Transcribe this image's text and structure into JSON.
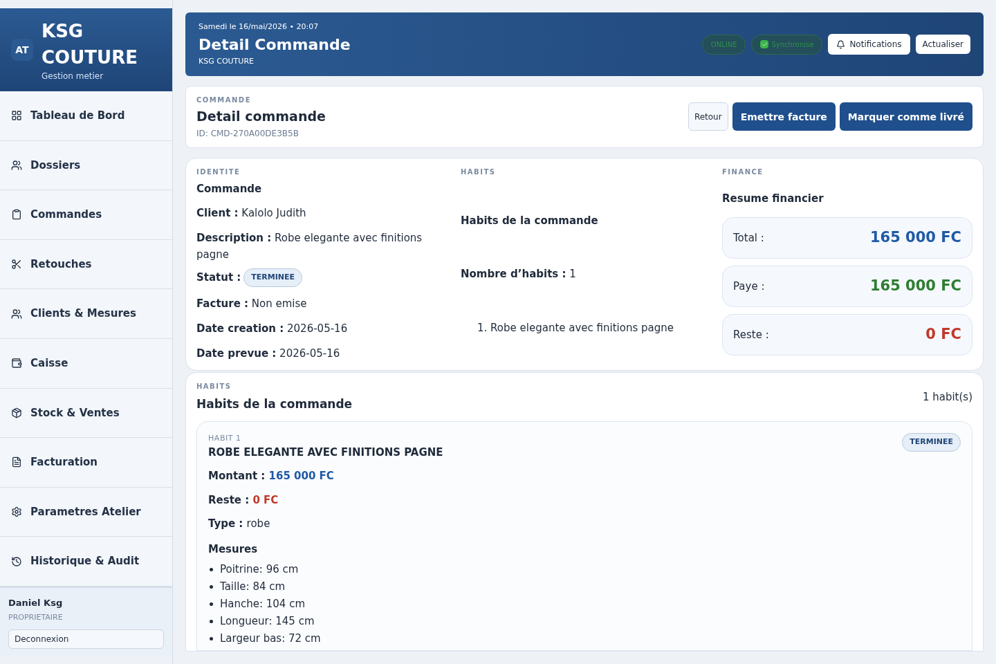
{
  "sidebar": {
    "logo_badge": "AT",
    "brand": "KSG COUTURE",
    "tagline": "Gestion metier",
    "items": [
      {
        "label": "Tableau de Bord",
        "selected": false
      },
      {
        "label": "Dossiers",
        "selected": false
      },
      {
        "label": "Commandes",
        "selected": false
      },
      {
        "label": "Retouches",
        "selected": false
      },
      {
        "label": "Clients & Mesures",
        "selected": false
      },
      {
        "label": "Caisse",
        "selected": false
      },
      {
        "label": "Stock & Ventes",
        "selected": false
      },
      {
        "label": "Facturation",
        "selected": false
      },
      {
        "label": "Parametres Atelier",
        "selected": false
      },
      {
        "label": "Historique & Audit",
        "selected": false
      }
    ],
    "user": {
      "name": "Daniel Ksg",
      "role": "PROPRIETAIRE",
      "logout": "Deconnexion"
    }
  },
  "header": {
    "date": "Samedi le 16/mai/2026 • 20:07",
    "title": "Detail Commande",
    "subtitle": "KSG COUTURE",
    "online": "ONLINE",
    "sync": {
      "label": "Synchronise",
      "checked": true
    },
    "notifications": "Notifications",
    "refresh": "Actualiser"
  },
  "order": {
    "eyebrow": "COMMANDE",
    "title": "Detail commande",
    "id": "ID: CMD-270A00DE3B5B",
    "buttons": [
      {
        "label": "Retour",
        "kind": "secondary"
      },
      {
        "label": "Emettre facture",
        "kind": "primary"
      },
      {
        "label": "Marquer comme livré",
        "kind": "primary"
      }
    ]
  },
  "identite": {
    "eyebrow": "IDENTITE",
    "title": "Commande",
    "fields": [
      {
        "label": "Client :",
        "value": "Kalolo Judith",
        "kind": "text"
      },
      {
        "label": "Description :",
        "value": "Robe elegante avec finitions pagne",
        "kind": "text"
      },
      {
        "label": "Statut :",
        "value": "TERMINEE",
        "kind": "badge"
      },
      {
        "label": "Facture :",
        "value": "Non emise",
        "kind": "text"
      },
      {
        "label": "Date creation :",
        "value": "2026-05-16",
        "kind": "text"
      },
      {
        "label": "Date prevue :",
        "value": "2026-05-16",
        "kind": "text"
      }
    ]
  },
  "habits_summary": {
    "eyebrow": "HABITS",
    "title": "Habits de la commande",
    "count_label": "Nombre d’habits :",
    "count": "1",
    "items": [
      {
        "number": "1.",
        "label": "Robe elegante avec finitions pagne"
      }
    ]
  },
  "finance": {
    "eyebrow": "FINANCE",
    "title": "Resume financier",
    "rows": [
      {
        "label": "Total :",
        "value": "165 000 FC",
        "kind": "total"
      },
      {
        "label": "Paye :",
        "value": "165 000 FC",
        "kind": "paid"
      },
      {
        "label": "Reste :",
        "value": "0 FC",
        "kind": "rest"
      }
    ]
  },
  "habits": {
    "eyebrow": "HABITS",
    "title": "Habits de la commande",
    "count": "1 habit(s)",
    "items": [
      {
        "eyebrow": "HABIT 1",
        "title": "ROBE ELEGANTE AVEC FINITIONS PAGNE",
        "status": "TERMINEE",
        "fields": [
          {
            "label": "Montant :",
            "value": "165 000 FC",
            "kind": "total"
          },
          {
            "label": "Reste :",
            "value": "0 FC",
            "kind": "rest"
          },
          {
            "label": "Type :",
            "value": "robe",
            "kind": "text"
          }
        ],
        "measures_title": "Mesures",
        "measures": [
          "Poitrine: 96 cm",
          "Taille: 84 cm",
          "Hanche: 104 cm",
          "Longueur: 145 cm",
          "Largeur bas: 72 cm"
        ]
      }
    ]
  }
}
